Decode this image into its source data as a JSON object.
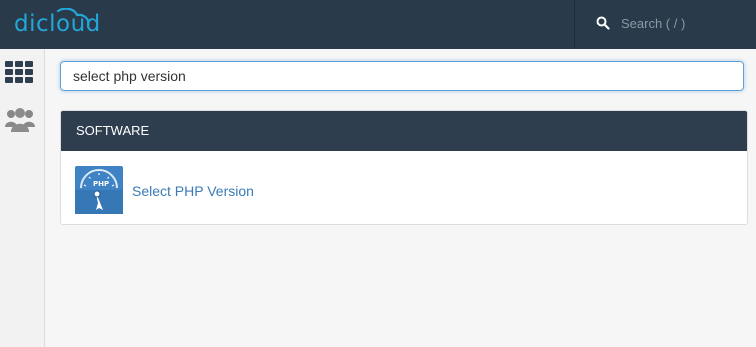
{
  "header": {
    "logo_text": "dicloud",
    "search_placeholder": "Search ( / )"
  },
  "sidebar": {
    "items": [
      {
        "icon": "grid-icon"
      },
      {
        "icon": "users-icon"
      }
    ]
  },
  "main": {
    "quickfind_value": "select php version",
    "group": {
      "title": "SOFTWARE",
      "items": [
        {
          "label": "Select PHP Version",
          "icon": "php-gauge-icon"
        }
      ]
    }
  },
  "colors": {
    "topbar": "#293a4a",
    "accent": "#23a6d8",
    "link": "#3a7ab8",
    "panel_header": "#2e3e4e"
  }
}
